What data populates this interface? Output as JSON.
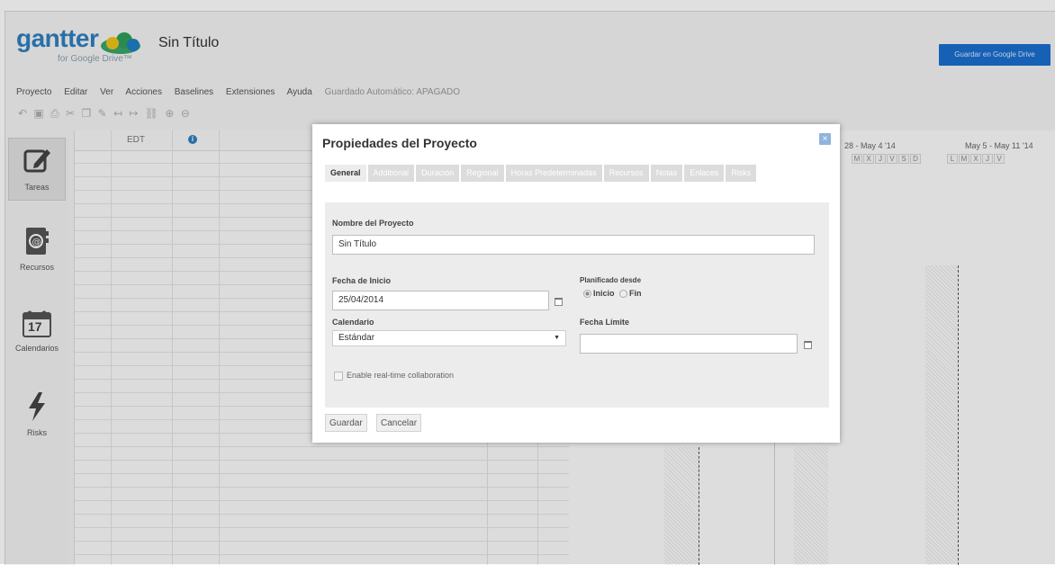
{
  "app": {
    "logo_word": "gantter",
    "logo_sub": "for Google Drive™",
    "doc_title": "Sin Título",
    "save_google": "Guardar en Google Drive"
  },
  "menu": {
    "items": [
      "Proyecto",
      "Editar",
      "Ver",
      "Acciones",
      "Baselines",
      "Extensiones",
      "Ayuda"
    ],
    "autosave": "Guardado Automático: APAGADO"
  },
  "nav": {
    "tareas": "Tareas",
    "recursos": "Recursos",
    "calendarios": "Calendarios",
    "calendar_day": "17",
    "risks": "Risks"
  },
  "grid": {
    "col_edt": "EDT",
    "col_info": "i"
  },
  "gantt": {
    "week1": "28 - May 4 '14",
    "week2": "May 5 - May 11 '14",
    "days1": [
      "M",
      "X",
      "J",
      "V",
      "S",
      "D"
    ],
    "days2": [
      "L",
      "M",
      "X",
      "J",
      "V"
    ]
  },
  "dialog": {
    "title": "Propiedades del Proyecto",
    "close": "×",
    "tabs": [
      "General",
      "Additional",
      "Duración",
      "Regional",
      "Horas Predeterminadas",
      "Recursos",
      "Notas",
      "Enlaces",
      "Risks"
    ],
    "active_tab": "General",
    "name_label": "Nombre del Proyecto",
    "name_value": "Sin Título",
    "start_label": "Fecha de Inicio",
    "start_value": "25/04/2014",
    "planned_label": "Planificado desde",
    "radio_start": "Inicio",
    "radio_end": "Fin",
    "calendar_label": "Calendario",
    "calendar_value": "Estándar",
    "deadline_label": "Fecha Límite",
    "deadline_value": "",
    "collab_label": "Enable real-time collaboration",
    "save_btn": "Guardar",
    "cancel_btn": "Cancelar"
  }
}
